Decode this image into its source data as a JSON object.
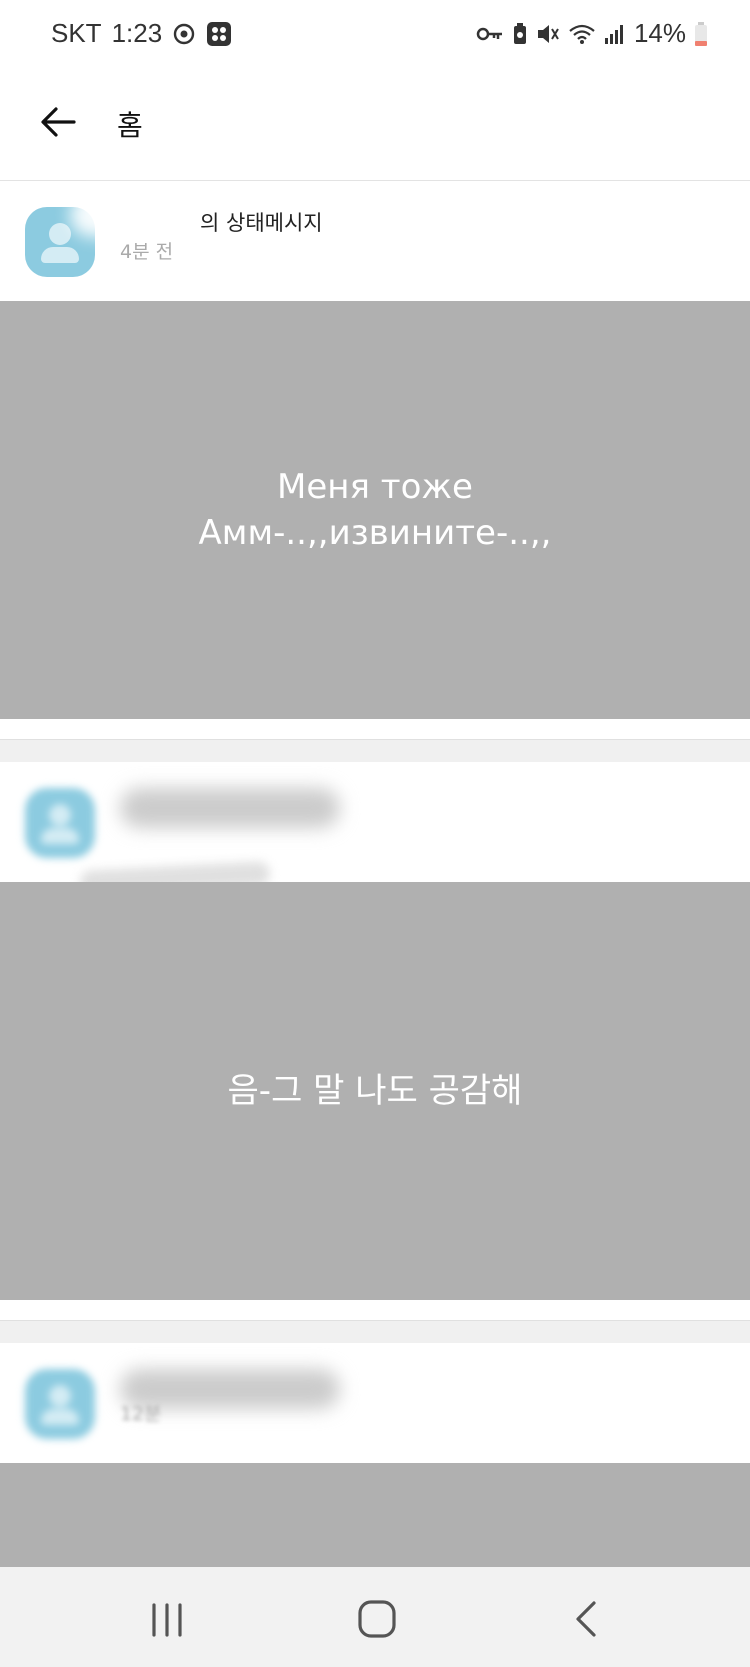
{
  "status_bar": {
    "carrier": "SKT",
    "time": "1:23",
    "battery": "14%"
  },
  "header": {
    "title": "홈"
  },
  "posts": [
    {
      "name_suffix": "의 상태메시지",
      "time": "4분 전",
      "image_text_line1": "Меня тоже",
      "image_text_line2": "Амм-..,,извините-..,,"
    },
    {
      "image_text_line1": "음-그 말 나도 공감해"
    },
    {
      "time": "12분"
    }
  ],
  "colors": {
    "image_placeholder": "#b0b0b0",
    "avatar": "#8ccbe0",
    "battery_low": "#f08070"
  }
}
